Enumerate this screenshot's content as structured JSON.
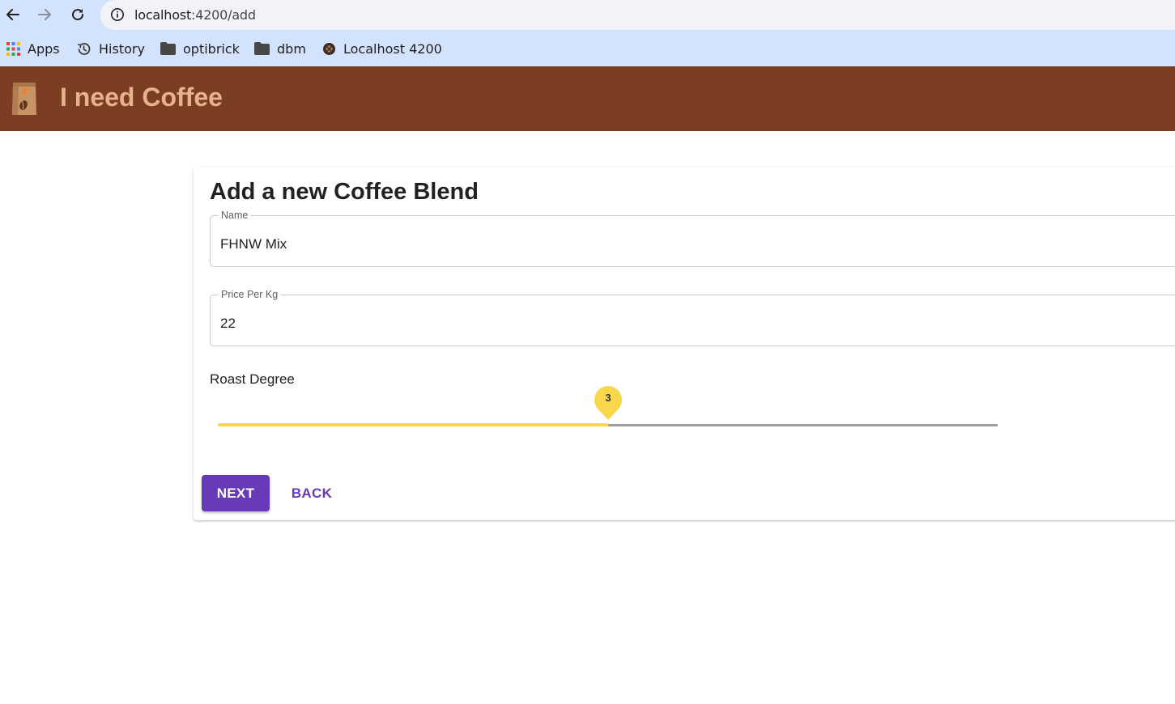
{
  "browser": {
    "url_host": "localhost",
    "url_path": ":4200/add",
    "icons": {
      "back": "arrow-left-icon",
      "forward": "arrow-right-icon",
      "reload": "reload-icon",
      "site_info": "info-icon"
    },
    "bookmarks": [
      {
        "label": "Apps",
        "icon": "apps-grid-icon"
      },
      {
        "label": "History",
        "icon": "history-icon"
      },
      {
        "label": "optibrick",
        "icon": "folder-icon"
      },
      {
        "label": "dbm",
        "icon": "folder-icon"
      },
      {
        "label": "Localhost 4200",
        "icon": "site-favicon-icon"
      }
    ]
  },
  "app": {
    "title": "I need Coffee",
    "logo_icon": "coffee-bag-icon",
    "header_color": "#7b3e22",
    "title_color": "#e6b38c"
  },
  "form": {
    "heading": "Add a new Coffee Blend",
    "name": {
      "label": "Name",
      "value": "FHNW Mix"
    },
    "price": {
      "label": "Price Per Kg",
      "value": "22"
    },
    "roast": {
      "label": "Roast Degree",
      "value": "3",
      "min": 1,
      "max": 5,
      "fraction": 0.5,
      "color": "#f8d84a"
    },
    "next_label": "NEXT",
    "back_label": "BACK",
    "accent_color": "#673ab7"
  }
}
